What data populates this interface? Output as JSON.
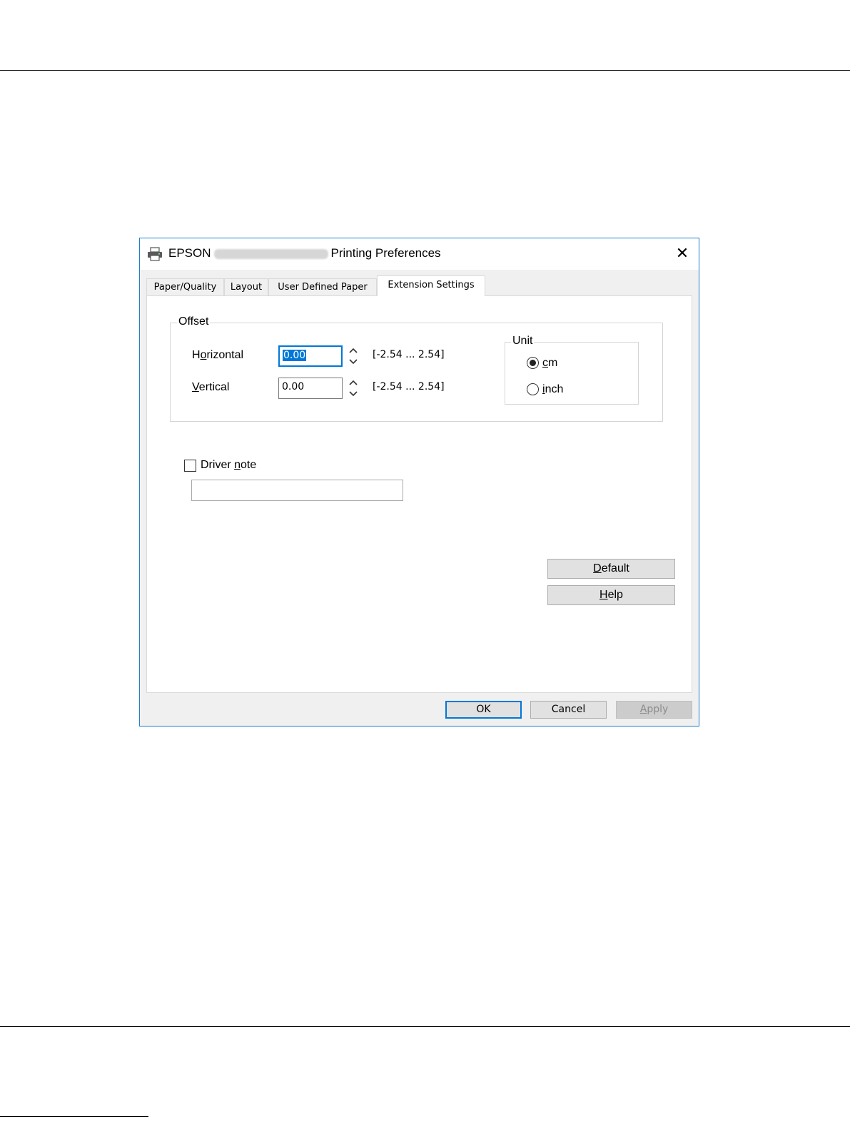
{
  "window": {
    "title_prefix": "EPSON",
    "title_suffix": "Printing Preferences",
    "close_label": "✕"
  },
  "tabs": [
    {
      "label": "Paper/Quality"
    },
    {
      "label": "Layout"
    },
    {
      "label": "User Defined Paper"
    },
    {
      "label": "Extension Settings",
      "active": true
    }
  ],
  "offset": {
    "group_label": "Offset",
    "horizontal": {
      "label_pre": "H",
      "label_ul": "o",
      "label_post": "rizontal",
      "value": "0.00",
      "range": "[-2.54 ... 2.54]"
    },
    "vertical": {
      "label_pre": "",
      "label_ul": "V",
      "label_post": "ertical",
      "value": "0.00",
      "range": "[-2.54 ... 2.54]"
    }
  },
  "unit": {
    "group_label": "Unit",
    "options": [
      {
        "label_ul": "c",
        "label_post": "m",
        "selected": true
      },
      {
        "label_ul": "i",
        "label_post": "nch",
        "selected": false
      }
    ]
  },
  "driver_note": {
    "label_pre": "Driver ",
    "label_ul": "n",
    "label_post": "ote",
    "checked": false,
    "value": ""
  },
  "side_buttons": {
    "default": {
      "ul": "D",
      "post": "efault"
    },
    "help": {
      "ul": "H",
      "post": "elp"
    }
  },
  "footer_buttons": {
    "ok": "OK",
    "cancel": "Cancel",
    "apply_ul": "A",
    "apply_post": "pply"
  }
}
